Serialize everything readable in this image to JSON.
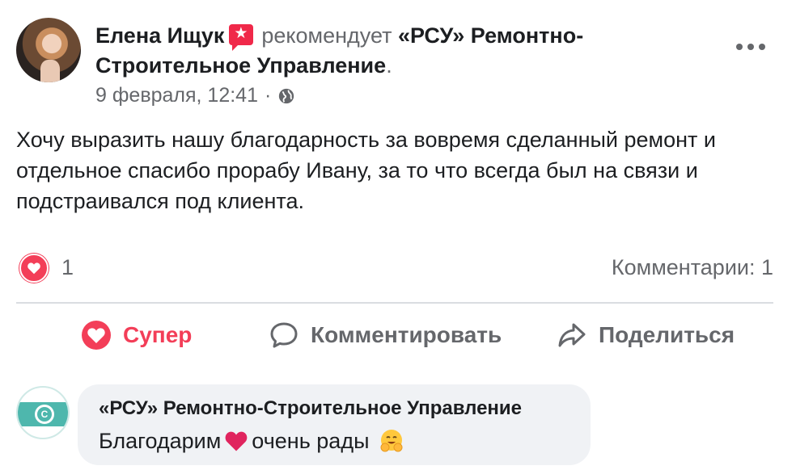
{
  "post": {
    "author": "Елена Ищук",
    "action_text": "рекомендует",
    "target_page": "«РСУ» Ремонтно-Строительное Управление",
    "trailing_period": ".",
    "date": "9 февраля, 12:41",
    "separator": "·",
    "privacy_icon": "globe-icon",
    "badge_icon": "recommend-star-icon",
    "body": "Хочу выразить нашу благодарность за вовремя сделанный ремонт и отдельное спасибо прорабу Ивану, за то что всегда был на связи и подстраивался под клиента."
  },
  "reactions": {
    "icon": "love-reaction-icon",
    "count": "1",
    "comments_label": "Комментарии: 1"
  },
  "actions": {
    "love_label": "Супер",
    "comment_label": "Комментировать",
    "share_label": "Поделиться"
  },
  "comment": {
    "author": "«РСУ» Ремонтно-Строительное Управление",
    "text_before": "Благодарим",
    "text_after": "очень рады"
  },
  "colors": {
    "accent_love": "#f33e58",
    "muted_text": "#65676b",
    "bubble_bg": "#f0f2f5",
    "badge_red": "#f02849"
  }
}
